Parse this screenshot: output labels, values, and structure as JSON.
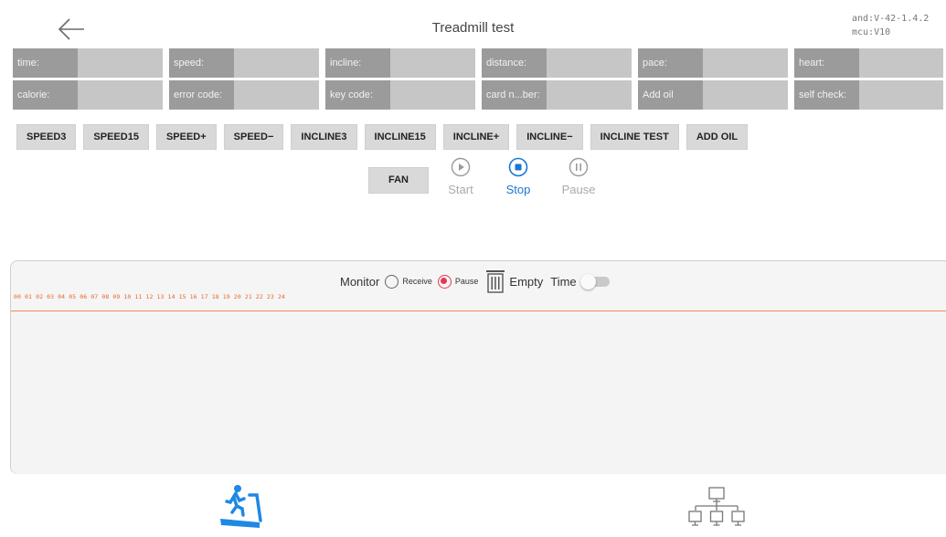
{
  "header": {
    "title": "Treadmill test",
    "version": "and:V-42-1.4.2\nmcu:V10"
  },
  "info_rows": [
    [
      "time:",
      "speed:",
      "incline:",
      "distance:",
      "pace:",
      "heart:"
    ],
    [
      "calorie:",
      "error code:",
      "key code:",
      "card n...ber:",
      "Add oil",
      "self check:"
    ]
  ],
  "buttons": [
    "SPEED3",
    "SPEED15",
    "SPEED+",
    "SPEED−",
    "INCLINE3",
    "INCLINE15",
    "INCLINE+",
    "INCLINE−",
    "INCLINE TEST",
    "ADD OIL"
  ],
  "fan_label": "FAN",
  "controls": {
    "start": "Start",
    "stop": "Stop",
    "pause": "Pause"
  },
  "monitor": {
    "title": "Monitor",
    "receive": "Receive",
    "pause": "Pause",
    "selected": "Pause",
    "empty": "Empty",
    "time": "Time",
    "hex_header": "00 01 02 03 04 05 06 07 08 09 10 11 12 13 14 15 16 17 18 19 20 21 22 23 24"
  },
  "colors": {
    "accent_blue": "#1976d2",
    "accent_red": "#e53950",
    "hex_orange": "#e8682a"
  },
  "nav": {
    "left_icon": "treadmill-icon",
    "right_icon": "network-icon"
  }
}
